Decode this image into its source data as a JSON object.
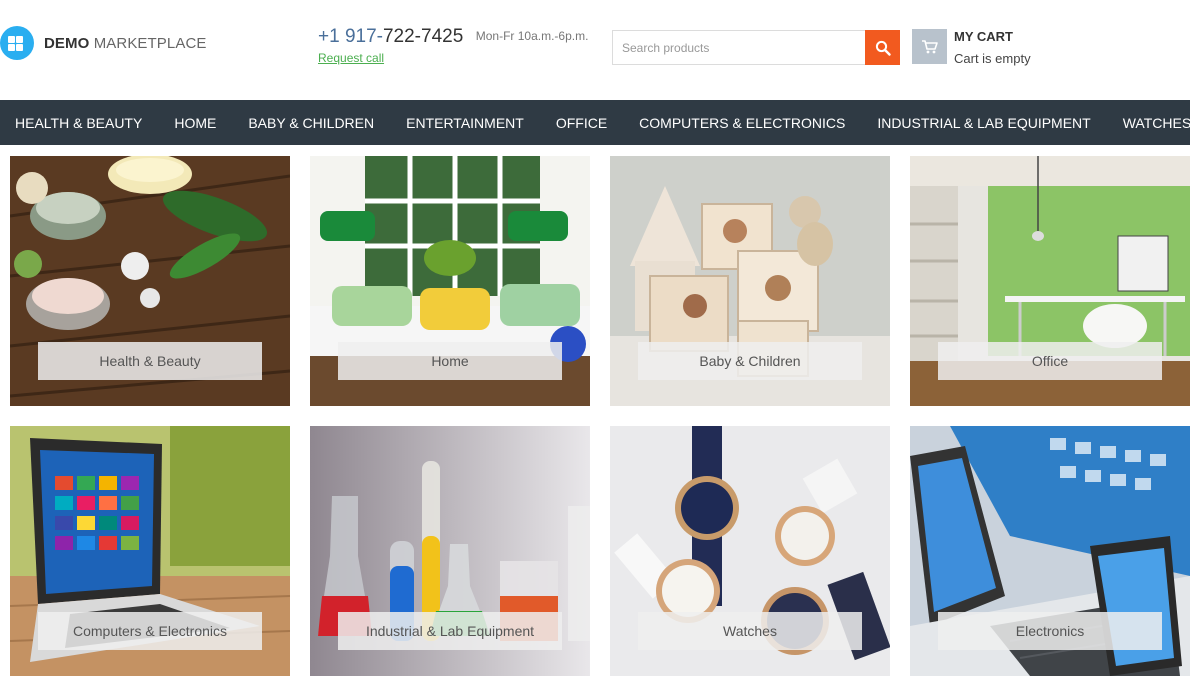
{
  "brand": {
    "name_bold": "DEMO",
    "name_rest": "MARKETPLACE",
    "accent_color": "#2aaef0"
  },
  "contact": {
    "phone_prefix": "+1 917-",
    "phone_rest": "722-7425",
    "hours": "Mon-Fr 10a.m.-6p.m.",
    "request_call": "Request call"
  },
  "search": {
    "placeholder": "Search products",
    "button_color": "#f25a1f",
    "icon": "search-icon"
  },
  "cart": {
    "title": "MY CART",
    "status": "Cart is empty",
    "icon": "cart-icon"
  },
  "nav": {
    "background": "#2f3a44",
    "items": [
      {
        "label": "HEALTH & BEAUTY"
      },
      {
        "label": "HOME"
      },
      {
        "label": "BABY & CHILDREN"
      },
      {
        "label": "ENTERTAINMENT"
      },
      {
        "label": "OFFICE"
      },
      {
        "label": "COMPUTERS & ELECTRONICS"
      },
      {
        "label": "INDUSTRIAL & LAB EQUIPMENT"
      },
      {
        "label": "WATCHES"
      }
    ]
  },
  "categories": [
    {
      "label": "Health & Beauty"
    },
    {
      "label": "Home"
    },
    {
      "label": "Baby & Children"
    },
    {
      "label": "Office"
    },
    {
      "label": "Computers & Electronics"
    },
    {
      "label": "Industrial & Lab Equipment"
    },
    {
      "label": "Watches"
    },
    {
      "label": "Electronics"
    }
  ]
}
